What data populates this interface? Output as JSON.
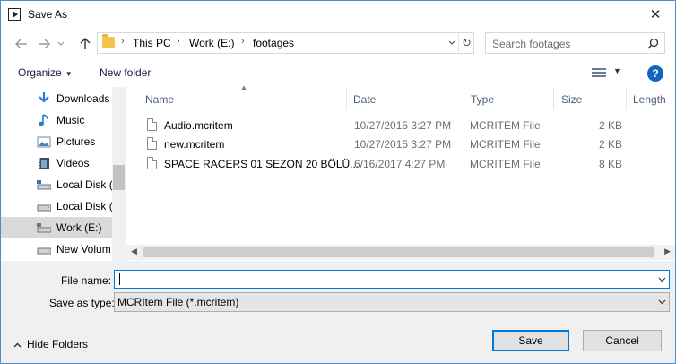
{
  "window": {
    "title": "Save As",
    "close_glyph": "✕"
  },
  "nav": {
    "back_icon": "arrow-left-icon",
    "forward_icon": "arrow-right-icon",
    "recent_icon": "chevron-down-icon",
    "up_icon": "arrow-up-icon"
  },
  "address": {
    "crumbs": [
      "This PC",
      "Work (E:)",
      "footages"
    ],
    "separator": "›",
    "dropdown_glyph": "⌄",
    "refresh_glyph": "↻"
  },
  "search": {
    "placeholder": "Search footages",
    "icon": "search-icon"
  },
  "toolbar": {
    "organize_label": "Organize",
    "organize_arrow": "▼",
    "new_folder_label": "New folder",
    "view_arrow": "▼",
    "help_label": "?"
  },
  "sidebar": {
    "items": [
      {
        "label": "Downloads",
        "icon": "download-icon",
        "selected": false
      },
      {
        "label": "Music",
        "icon": "music-icon",
        "selected": false
      },
      {
        "label": "Pictures",
        "icon": "pictures-icon",
        "selected": false
      },
      {
        "label": "Videos",
        "icon": "videos-icon",
        "selected": false
      },
      {
        "label": "Local Disk (",
        "icon": "drive-icon",
        "selected": false
      },
      {
        "label": "Local Disk (",
        "icon": "drive-icon",
        "selected": false
      },
      {
        "label": "Work (E:)",
        "icon": "drive-icon",
        "selected": true
      },
      {
        "label": "New Volum",
        "icon": "drive-icon",
        "selected": false
      }
    ]
  },
  "filelist": {
    "columns": [
      "Name",
      "Date",
      "Type",
      "Size",
      "Length"
    ],
    "sort_arrow": "▲",
    "rows": [
      {
        "name": "Audio.mcritem",
        "date": "10/27/2015 3:27 PM",
        "type": "MCRITEM File",
        "size": "2 KB"
      },
      {
        "name": "new.mcritem",
        "date": "10/27/2015 3:27 PM",
        "type": "MCRITEM File",
        "size": "2 KB"
      },
      {
        "name": "SPACE RACERS 01 SEZON 20 BÖLÜ...",
        "date": "6/16/2017 4:27 PM",
        "type": "MCRITEM File",
        "size": "8 KB"
      }
    ],
    "scroll_left": "◀",
    "scroll_right": "▶"
  },
  "form": {
    "filename_label": "File name:",
    "filename_value": "",
    "savetype_label": "Save as type:",
    "savetype_value": "MCRItem File (*.mcritem)",
    "dropdown_arrow": "▼"
  },
  "footer": {
    "hide_folders_label": "Hide Folders",
    "hide_glyph": "▲",
    "save_label": "Save",
    "cancel_label": "Cancel"
  },
  "colors": {
    "accent": "#0078d7",
    "help": "#1565c0",
    "selected_row": "#d9d9d9"
  }
}
